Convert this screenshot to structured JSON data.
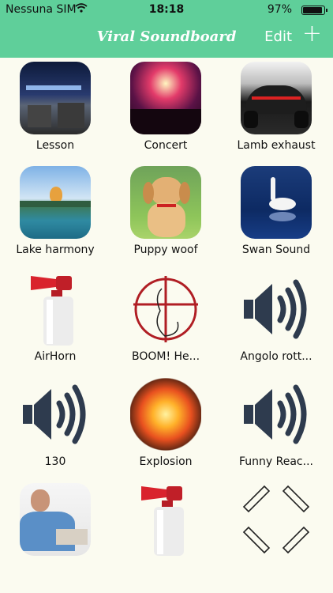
{
  "status_bar": {
    "carrier": "Nessuna SIM",
    "time": "18:18",
    "battery_percent": "97%",
    "battery_level": 0.97
  },
  "nav": {
    "title": "Viral Soundboard",
    "edit_label": "Edit",
    "add_label": "+"
  },
  "sounds": [
    {
      "label": "Lesson",
      "icon": "lecture-photo"
    },
    {
      "label": "Concert",
      "icon": "concert-photo"
    },
    {
      "label": "Lamb exhaust",
      "icon": "car-photo"
    },
    {
      "label": "Lake harmony",
      "icon": "lake-photo"
    },
    {
      "label": "Puppy woof",
      "icon": "puppy-photo"
    },
    {
      "label": "Swan Sound",
      "icon": "swan-photo"
    },
    {
      "label": "AirHorn",
      "icon": "airhorn"
    },
    {
      "label": "BOOM! He...",
      "icon": "crosshair"
    },
    {
      "label": "Angolo rott...",
      "icon": "speaker"
    },
    {
      "label": "130",
      "icon": "speaker"
    },
    {
      "label": "Explosion",
      "icon": "explosion-photo"
    },
    {
      "label": "Funny Reac...",
      "icon": "speaker"
    },
    {
      "label": "",
      "icon": "man-photo"
    },
    {
      "label": "",
      "icon": "airhorn"
    },
    {
      "label": "",
      "icon": "collapse-arrows"
    }
  ],
  "colors": {
    "header": "#5fcf9a",
    "background": "#fbfbf0",
    "speaker": "#2e3b4e"
  }
}
